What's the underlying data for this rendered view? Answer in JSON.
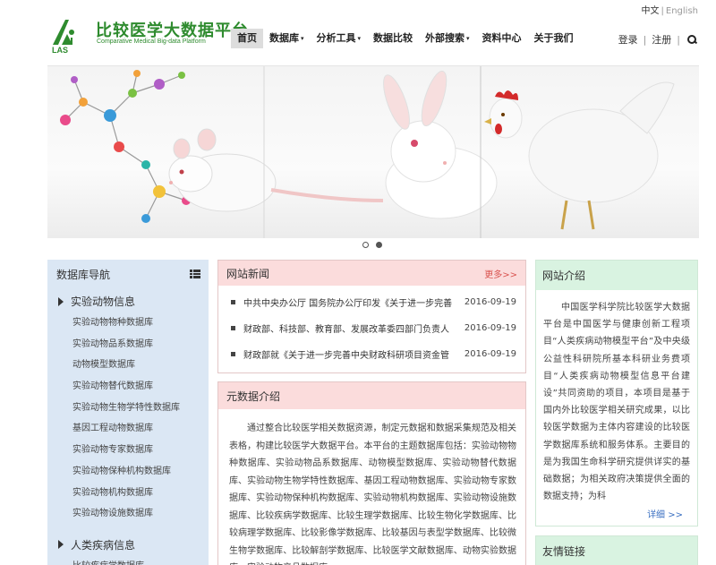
{
  "lang": {
    "zh": "中文",
    "separator": "|",
    "en": "English"
  },
  "logo": {
    "title": "比较医学大数据平台",
    "subtitle": "Comparative Medical Big-data Platform",
    "mark_text": "LAS"
  },
  "nav": {
    "items": [
      {
        "label": "首页",
        "active": true,
        "dropdown": false
      },
      {
        "label": "数据库",
        "active": false,
        "dropdown": true
      },
      {
        "label": "分析工具",
        "active": false,
        "dropdown": true
      },
      {
        "label": "数据比较",
        "active": false,
        "dropdown": false
      },
      {
        "label": "外部搜索",
        "active": false,
        "dropdown": true
      },
      {
        "label": "资料中心",
        "active": false,
        "dropdown": false
      },
      {
        "label": "关于我们",
        "active": false,
        "dropdown": false
      }
    ],
    "caret": "▾"
  },
  "user": {
    "login": "登录",
    "register": "注册",
    "separator": "|"
  },
  "sidebar": {
    "title": "数据库导航",
    "sections": [
      {
        "title": "实验动物信息",
        "items": [
          "实验动物物种数据库",
          "实验动物品系数据库",
          "动物模型数据库",
          "实验动物替代数据库",
          "实验动物生物学特性数据库",
          "基因工程动物数据库",
          "实验动物专家数据库",
          "实验动物保种机构数据库",
          "实验动物机构数据库",
          "实验动物设施数据库"
        ]
      },
      {
        "title": "人类疾病信息",
        "items": [
          "比较疾病学数据库"
        ]
      }
    ]
  },
  "news": {
    "title": "网站新闻",
    "more": "更多>>",
    "items": [
      {
        "text": "中共中央办公厅 国务院办公厅印发《关于进一步完善",
        "date": "2016-09-19"
      },
      {
        "text": "财政部、科技部、教育部、发展改革委四部门负责人",
        "date": "2016-09-19"
      },
      {
        "text": "财政部就《关于进一步完善中央财政科研项目资金管",
        "date": "2016-09-19"
      }
    ]
  },
  "meta_intro": {
    "title": "元数据介绍",
    "text": "通过整合比较医学相关数据资源，制定元数据和数据采集规范及相关表格，构建比较医学大数据平台。本平台的主题数据库包括：实验动物物种数据库、实验动物品系数据库、动物模型数据库、实验动物替代数据库、实验动物生物学特性数据库、基因工程动物数据库、实验动物专家数据库、实验动物保种机构数据库、实验动物机构数据库、实验动物设施数据库、比较疾病学数据库、比较生理学数据库、比较生物化学数据库、比较病理学数据库、比较影像学数据库、比较基因与表型学数据库、比较微生物学数据库、比较解剖学数据库、比较医学文献数据库、动物实验数据库、实验动物产品数据库。"
  },
  "site_intro": {
    "title": "网站介绍",
    "text": "中国医学科学院比较医学大数据平台是中国医学与健康创新工程项目“人类疾病动物模型平台”及中央级公益性科研院所基本科研业务费项目“人类疾病动物模型信息平台建设”共同资助的项目，本项目是基于国内外比较医学相关研究成果，以比较医学数据为主体内容建设的比较医学数据库系统和服务体系。主要目的是为我国生命科学研究提供详实的基础数据；为相关政府决策提供全面的数据支持；为科",
    "detail": "详细 >>"
  },
  "links": {
    "title": "友情链接"
  },
  "banner": {
    "slides": 2,
    "active_slide": 0
  },
  "colors": {
    "brand_green": "#2e8b2e",
    "sidebar_bg": "#dbe7f4",
    "news_head_bg": "#fbdcdc",
    "right_head_bg": "#d9f3e1",
    "more_link": "#d9534f",
    "detail_link": "#3a6fc1"
  }
}
